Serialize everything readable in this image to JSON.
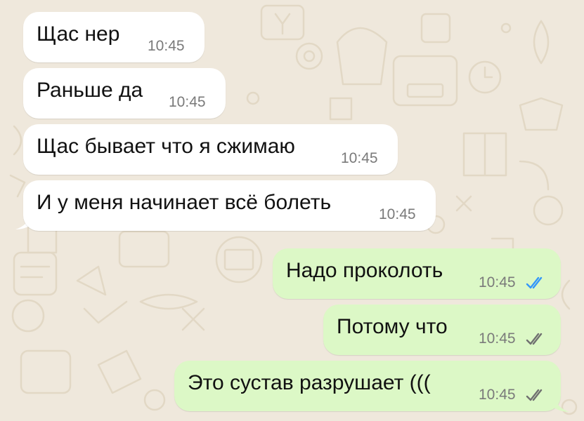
{
  "theme": {
    "background": "#efe8dc",
    "incoming_bubble": "#ffffff",
    "outgoing_bubble": "#dcf8c6",
    "read_tick_color": "#3497f9",
    "delivered_tick_color": "#707070"
  },
  "messages": [
    {
      "direction": "incoming",
      "text": "Щас нер",
      "time": "10:45"
    },
    {
      "direction": "incoming",
      "text": "Раньше да",
      "time": "10:45"
    },
    {
      "direction": "incoming",
      "text": "Щас бывает что я сжимаю",
      "time": "10:45"
    },
    {
      "direction": "incoming",
      "text": "И у меня начинает всё болеть",
      "time": "10:45"
    },
    {
      "direction": "outgoing",
      "text": "Надо проколоть",
      "time": "10:45",
      "status": "read"
    },
    {
      "direction": "outgoing",
      "text": "Потому что",
      "time": "10:45",
      "status": "delivered"
    },
    {
      "direction": "outgoing",
      "text": "Это сустав разрушает (((",
      "time": "10:45",
      "status": "delivered"
    }
  ]
}
